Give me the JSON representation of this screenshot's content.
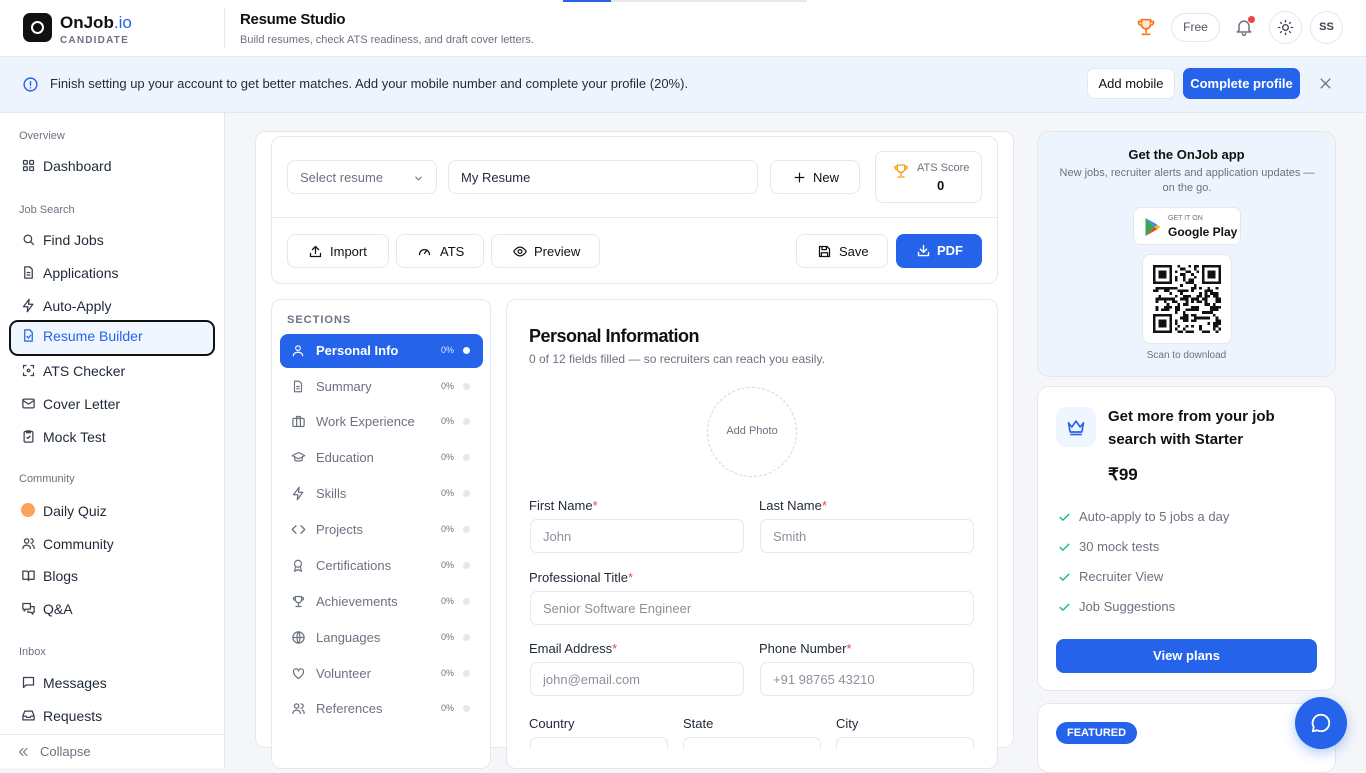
{
  "brand": {
    "name": "OnJob",
    "suffix": ".io",
    "role": "CANDIDATE"
  },
  "header": {
    "title": "Resume Studio",
    "subtitle": "Build resumes, check ATS readiness, and draft cover letters.",
    "plan_badge": "Free",
    "avatar_initials": "SS",
    "icons": [
      "trophy-icon",
      "bell-icon",
      "sun-icon"
    ]
  },
  "banner": {
    "text": "Finish setting up your account to get better matches. Add your mobile number and complete your profile (20%).",
    "add_mobile": "Add mobile",
    "complete_profile": "Complete profile"
  },
  "sidebar": {
    "sections": {
      "overview": "Overview",
      "job_search": "Job Search",
      "community": "Community",
      "inbox": "Inbox"
    },
    "items": [
      {
        "label": "Dashboard",
        "icon": "grid-icon"
      },
      {
        "label": "Find Jobs",
        "icon": "search-icon"
      },
      {
        "label": "Applications",
        "icon": "file-icon"
      },
      {
        "label": "Auto-Apply",
        "icon": "bolt-icon"
      },
      {
        "label": "Resume Builder",
        "icon": "resume-icon",
        "active": true
      },
      {
        "label": "ATS Checker",
        "icon": "scan-icon"
      },
      {
        "label": "Cover Letter",
        "icon": "mail-icon"
      },
      {
        "label": "Mock Test",
        "icon": "clipboard-icon"
      },
      {
        "label": "Daily Quiz",
        "icon": "quiz-icon"
      },
      {
        "label": "Community",
        "icon": "users-icon"
      },
      {
        "label": "Blogs",
        "icon": "book-icon"
      },
      {
        "label": "Q&A",
        "icon": "qa-icon"
      },
      {
        "label": "Messages",
        "icon": "message-icon"
      },
      {
        "label": "Requests",
        "icon": "inbox-icon"
      }
    ],
    "collapse": "Collapse"
  },
  "toolbar": {
    "select_placeholder": "Select resume",
    "resume_name": "My Resume",
    "new_label": "New",
    "ats_label": "ATS Score",
    "ats_value": "0",
    "import_label": "Import",
    "ats_btn_label": "ATS",
    "preview_label": "Preview",
    "save_label": "Save",
    "pdf_label": "PDF"
  },
  "sections": {
    "title": "SECTIONS",
    "items": [
      {
        "label": "Personal Info",
        "pct": "0%",
        "icon": "user-icon",
        "active": true
      },
      {
        "label": "Summary",
        "pct": "0%",
        "icon": "document-icon"
      },
      {
        "label": "Work Experience",
        "pct": "0%",
        "icon": "briefcase-icon"
      },
      {
        "label": "Education",
        "pct": "0%",
        "icon": "graduation-cap-icon"
      },
      {
        "label": "Skills",
        "pct": "0%",
        "icon": "bolt-icon"
      },
      {
        "label": "Projects",
        "pct": "0%",
        "icon": "code-icon"
      },
      {
        "label": "Certifications",
        "pct": "0%",
        "icon": "award-icon"
      },
      {
        "label": "Achievements",
        "pct": "0%",
        "icon": "trophy-icon"
      },
      {
        "label": "Languages",
        "pct": "0%",
        "icon": "globe-icon"
      },
      {
        "label": "Volunteer",
        "pct": "0%",
        "icon": "heart-icon"
      },
      {
        "label": "References",
        "pct": "0%",
        "icon": "users-icon"
      }
    ]
  },
  "form": {
    "title": "Personal Information",
    "subtitle": "0 of 12 fields filled — so recruiters can reach you easily.",
    "add_photo": "Add Photo",
    "first_name": {
      "label": "First Name",
      "placeholder": "John"
    },
    "last_name": {
      "label": "Last Name",
      "placeholder": "Smith"
    },
    "professional_title": {
      "label": "Professional Title",
      "placeholder": "Senior Software Engineer"
    },
    "email": {
      "label": "Email Address",
      "placeholder": "john@email.com"
    },
    "phone": {
      "label": "Phone Number",
      "placeholder": "+91 98765 43210"
    },
    "country": {
      "label": "Country"
    },
    "state": {
      "label": "State"
    },
    "city": {
      "label": "City"
    },
    "required_mark": "*"
  },
  "app_promo": {
    "title": "Get the OnJob app",
    "description": "New jobs, recruiter alerts and application updates — on the go.",
    "store_small": "GET IT ON",
    "store_big": "Google Play",
    "scan_text": "Scan to download"
  },
  "plan": {
    "headline": "Get more from your job search with Starter",
    "price": "₹99",
    "features": [
      "Auto-apply to 5 jobs a day",
      "30 mock tests",
      "Recruiter View",
      "Job Suggestions"
    ],
    "cta": "View plans"
  },
  "featured": {
    "badge": "FEATURED"
  },
  "colors": {
    "accent": "#2563eb",
    "danger": "#ef4444",
    "banner_bg": "#eef4fd"
  }
}
